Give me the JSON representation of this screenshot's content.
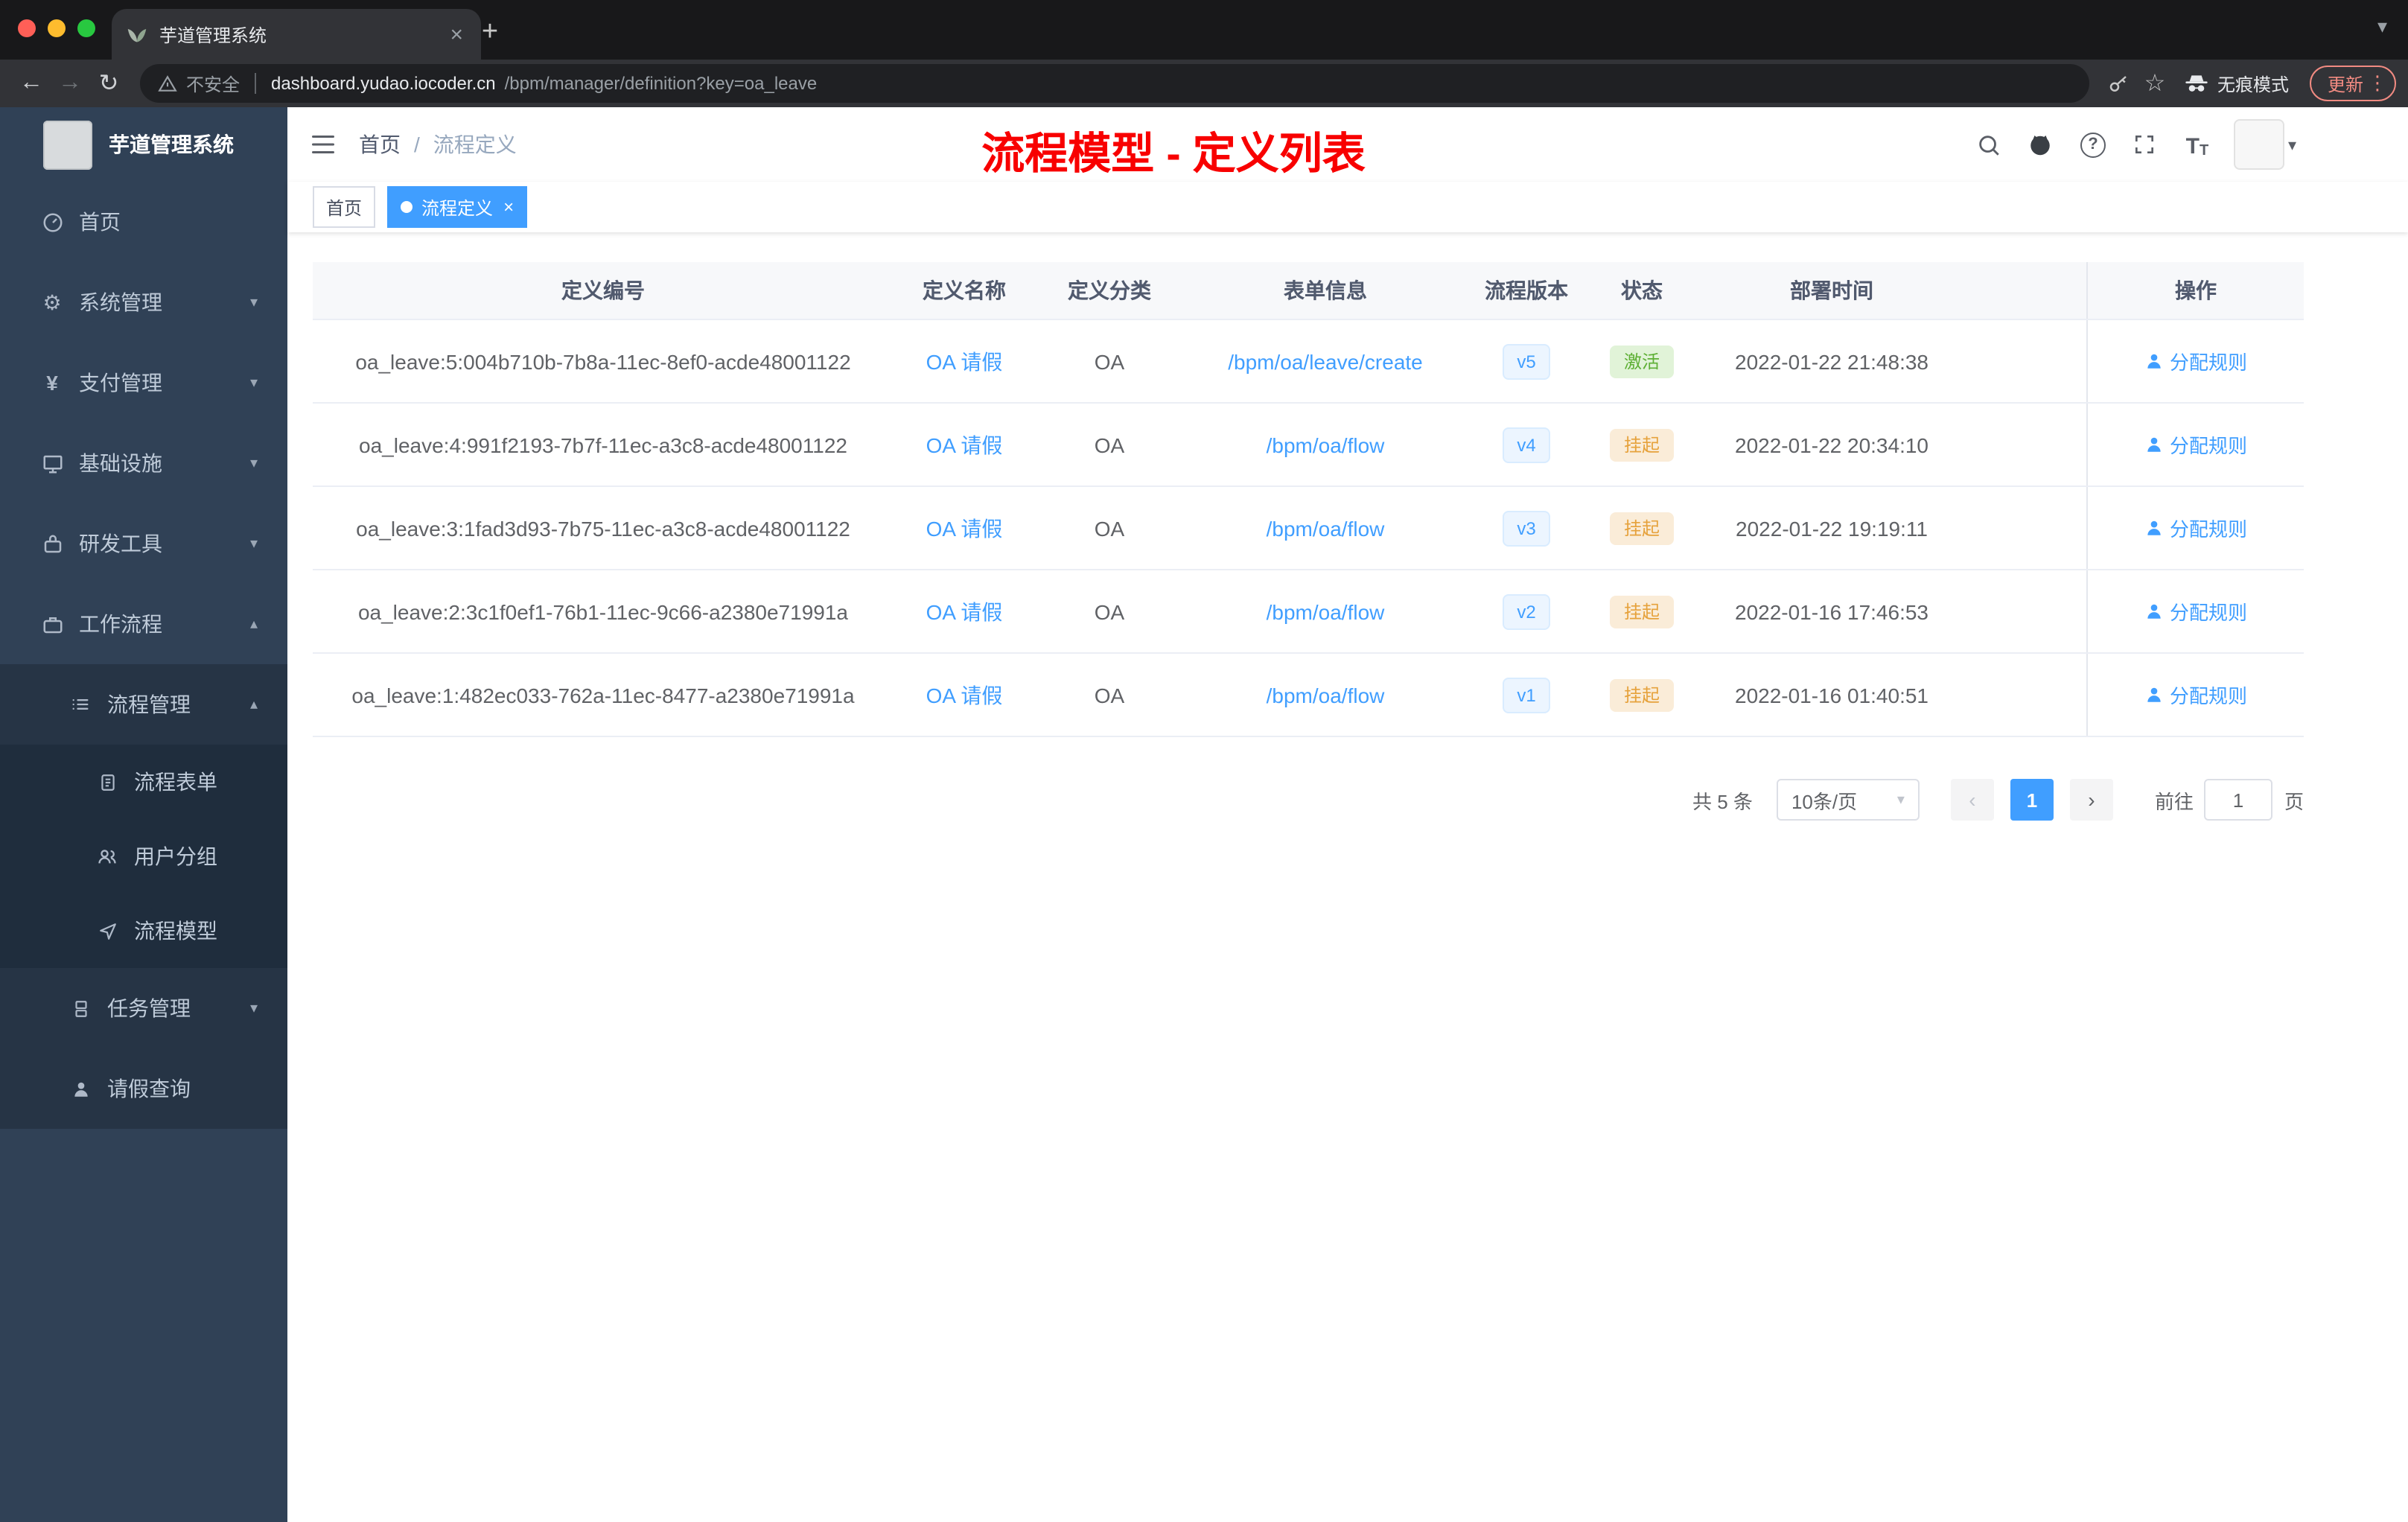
{
  "browser": {
    "tab": {
      "title": "芋道管理系统"
    },
    "address": {
      "security_label": "不安全",
      "domain": "dashboard.yudao.iocoder.cn",
      "path": "/bpm/manager/definition?key=oa_leave"
    },
    "incognito_label": "无痕模式",
    "update_label": "更新"
  },
  "sidebar": {
    "app_title": "芋道管理系统",
    "items": [
      {
        "label": "首页"
      },
      {
        "label": "系统管理"
      },
      {
        "label": "支付管理"
      },
      {
        "label": "基础设施"
      },
      {
        "label": "研发工具"
      },
      {
        "label": "工作流程"
      },
      {
        "label": "流程管理"
      },
      {
        "label": "流程表单"
      },
      {
        "label": "用户分组"
      },
      {
        "label": "流程模型"
      },
      {
        "label": "任务管理"
      },
      {
        "label": "请假查询"
      }
    ]
  },
  "navbar": {
    "breadcrumb": {
      "home": "首页",
      "separator": "/",
      "current": "流程定义"
    },
    "overlay_title": "流程模型 - 定义列表"
  },
  "tags": {
    "home": "首页",
    "active": "流程定义",
    "close": "×"
  },
  "table": {
    "headers": [
      "定义编号",
      "定义名称",
      "定义分类",
      "表单信息",
      "流程版本",
      "状态",
      "部署时间",
      "操作"
    ],
    "action_label": "分配规则",
    "rows": [
      {
        "id": "oa_leave:5:004b710b-7b8a-11ec-8ef0-acde48001122",
        "name": "OA 请假",
        "category": "OA",
        "form": "/bpm/oa/leave/create",
        "version": "v5",
        "status": "激活",
        "status_type": "success",
        "deployed_at": "2022-01-22 21:48:38"
      },
      {
        "id": "oa_leave:4:991f2193-7b7f-11ec-a3c8-acde48001122",
        "name": "OA 请假",
        "category": "OA",
        "form": "/bpm/oa/flow",
        "version": "v4",
        "status": "挂起",
        "status_type": "warning",
        "deployed_at": "2022-01-22 20:34:10"
      },
      {
        "id": "oa_leave:3:1fad3d93-7b75-11ec-a3c8-acde48001122",
        "name": "OA 请假",
        "category": "OA",
        "form": "/bpm/oa/flow",
        "version": "v3",
        "status": "挂起",
        "status_type": "warning",
        "deployed_at": "2022-01-22 19:19:11"
      },
      {
        "id": "oa_leave:2:3c1f0ef1-76b1-11ec-9c66-a2380e71991a",
        "name": "OA 请假",
        "category": "OA",
        "form": "/bpm/oa/flow",
        "version": "v2",
        "status": "挂起",
        "status_type": "warning",
        "deployed_at": "2022-01-16 17:46:53"
      },
      {
        "id": "oa_leave:1:482ec033-762a-11ec-8477-a2380e71991a",
        "name": "OA 请假",
        "category": "OA",
        "form": "/bpm/oa/flow",
        "version": "v1",
        "status": "挂起",
        "status_type": "warning",
        "deployed_at": "2022-01-16 01:40:51"
      }
    ]
  },
  "pagination": {
    "total": "共 5 条",
    "page_size": "10条/页",
    "current_page": "1",
    "goto_label": "前往",
    "goto_value": "1",
    "page_unit": "页"
  },
  "colors": {
    "accent": "#409eff",
    "success": "#67c23a",
    "warning": "#e6a23c",
    "annotation": "#f80000"
  }
}
